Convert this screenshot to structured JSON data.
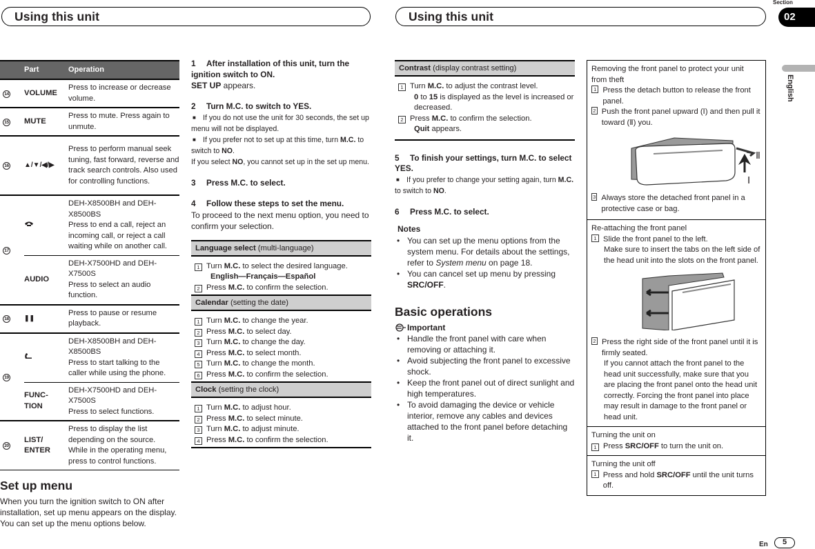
{
  "header": {
    "left_title": "Using this unit",
    "right_title": "Using this unit",
    "section_label": "Section",
    "section_number": "02",
    "language_tab": "English"
  },
  "parts_table": {
    "columns": [
      "Part",
      "Operation"
    ],
    "rows": [
      {
        "num": "14",
        "part": "VOLUME",
        "operation": "Press to increase or decrease volume."
      },
      {
        "num": "15",
        "part": "MUTE",
        "operation": "Press to mute. Press again to unmute."
      },
      {
        "num": "16",
        "part": "▲/▼/◀/▶",
        "operation": "Press to perform manual seek tuning, fast forward, reverse and track search controls. Also used for controlling functions."
      },
      {
        "num": "17",
        "part_icon": "phone-hang-up-icon",
        "part": "☎",
        "model": "DEH-X8500BH and DEH-X8500BS",
        "operation": "Press to end a call, reject an incoming call, or reject a call waiting while on another call."
      },
      {
        "num": "",
        "part": "AUDIO",
        "model": "DEH-X7500HD and DEH-X7500S",
        "operation": "Press to select an audio function."
      },
      {
        "num": "18",
        "part": "❚❚",
        "operation": "Press to pause or resume playback."
      },
      {
        "num": "19",
        "part_icon": "phone-answer-icon",
        "part": "✆",
        "model": "DEH-X8500BH and DEH-X8500BS",
        "operation": "Press to start talking to the caller while using the phone."
      },
      {
        "num": "",
        "part": "FUNC-TION",
        "model": "DEH-X7500HD and DEH-X7500S",
        "operation": "Press to select functions."
      },
      {
        "num": "20",
        "part": "LIST/ ENTER",
        "operation": "Press to display the list depending on the source.",
        "operation2": "While in the operating menu, press to control functions."
      }
    ]
  },
  "setup_menu": {
    "heading": "Set up menu",
    "intro": "When you turn the ignition switch to ON after installation, set up menu appears on the display. You can set up the menu options below."
  },
  "steps": {
    "s1": {
      "num": "1",
      "title": "After installation of this unit, turn the ignition switch to ON.",
      "b": "SET UP",
      "t": " appears."
    },
    "s2": {
      "num": "2",
      "title": "Turn M.C. to switch to YES.",
      "n1": "If you do not use the unit for 30 seconds, the set up menu will not be displayed.",
      "n2a": "If you prefer not to set up at this time, turn ",
      "n2b": "M.C.",
      "n2c": " to switch to ",
      "n2d": "NO",
      "n2e": ".",
      "n3a": "If you select ",
      "n3b": "NO",
      "n3c": ", you cannot set up in the set up menu."
    },
    "s3": {
      "num": "3",
      "title": "Press M.C. to select."
    },
    "s4": {
      "num": "4",
      "title": "Follow these steps to set the menu.",
      "text": "To proceed to the next menu option, you need to confirm your selection."
    },
    "s5": {
      "num": "5",
      "title": "To finish your settings, turn M.C. to select YES.",
      "n1a": "If you prefer to change your setting again, turn ",
      "n1b": "M.C.",
      "n1c": " to switch to ",
      "n1d": "NO",
      "n1e": "."
    },
    "s6": {
      "num": "6",
      "title": "Press M.C. to select."
    }
  },
  "menus": {
    "language": {
      "name": "Language select",
      "desc": " (multi-language)",
      "i1a": "Turn ",
      "i1b": "M.C.",
      "i1c": " to select the desired language.",
      "opts": "English—Français—Español",
      "i2a": "Press ",
      "i2b": "M.C.",
      "i2c": " to confirm the selection."
    },
    "calendar": {
      "name": "Calendar",
      "desc": " (setting the date)",
      "items": [
        {
          "v": "Turn",
          "t": "to change the year."
        },
        {
          "v": "Press",
          "t": "to select day."
        },
        {
          "v": "Turn",
          "t": "to change the day."
        },
        {
          "v": "Press",
          "t": "to select month."
        },
        {
          "v": "Turn",
          "t": "to change the month."
        },
        {
          "v": "Press",
          "t": "to confirm the selection."
        }
      ]
    },
    "clock": {
      "name": "Clock",
      "desc": " (setting the clock)",
      "items": [
        {
          "v": "Turn",
          "t": "to adjust hour."
        },
        {
          "v": "Press",
          "t": "to select minute."
        },
        {
          "v": "Turn",
          "t": "to adjust minute."
        },
        {
          "v": "Press",
          "t": "to confirm the selection."
        }
      ]
    },
    "contrast": {
      "name": "Contrast",
      "desc": " (display contrast setting)",
      "i1a": "Turn ",
      "i1b": "M.C.",
      "i1c": " to adjust the contrast level.",
      "r1": "0",
      "r2": " to ",
      "r3": "15",
      "r4": " is displayed as the level is increased or decreased.",
      "i2a": "Press ",
      "i2b": "M.C.",
      "i2c": " to confirm the selection.",
      "q1": "Quit",
      "q2": " appears."
    },
    "mc": "M.C."
  },
  "notes": {
    "heading": "Notes",
    "n1a": "You can set up the menu options from the system menu. For details about the settings, refer to ",
    "n1b": "System menu",
    "n1c": " on page 18.",
    "n2a": "You can cancel set up menu by pressing ",
    "n2b": "SRC/OFF",
    "n2c": "."
  },
  "basic_operations": {
    "heading": "Basic operations",
    "important": "Important",
    "bullets": [
      "Handle the front panel with care when removing or attaching it.",
      "Avoid subjecting the front panel to excessive shock.",
      "Keep the front panel out of direct sunlight and high temperatures.",
      "To avoid damaging the device or vehicle interior, remove any cables and devices attached to the front panel before detaching it."
    ]
  },
  "right_box": {
    "remove": {
      "title": "Removing the front panel to protect your unit from theft",
      "i1": "Press the detach button to release the front panel.",
      "i2": "Push the front panel upward (Ⅰ) and then pull it toward (Ⅱ) you.",
      "i3": "Always store the detached front panel in a protective case or bag.",
      "label_1": "Ⅰ",
      "label_2": "Ⅱ"
    },
    "reattach": {
      "title": "Re-attaching the front panel",
      "i1": "Slide the front panel to the left.",
      "i1b": "Make sure to insert the tabs on the left side of the head unit into the slots on the front panel.",
      "i2": "Press the right side of the front panel until it is firmly seated.",
      "i2b": "If you cannot attach the front panel to the head unit successfully, make sure that you are placing the front panel onto the head unit correctly. Forcing the front panel into place may result in damage to the front panel or head unit."
    },
    "on": {
      "title": "Turning the unit on",
      "a": "Press ",
      "b": "SRC/OFF",
      "c": " to turn the unit on."
    },
    "off": {
      "title": "Turning the unit off",
      "a": "Press and hold ",
      "b": "SRC/OFF",
      "c": " until the unit turns off."
    }
  },
  "footer": {
    "lang": "En",
    "page": "5"
  }
}
